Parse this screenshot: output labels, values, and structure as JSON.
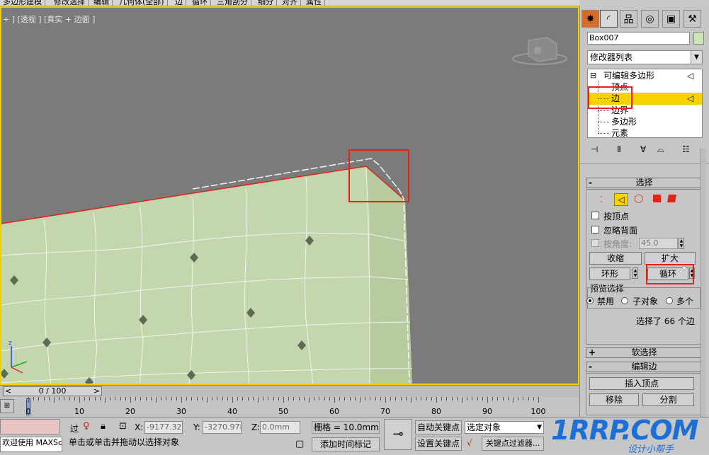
{
  "ribbon": {
    "tabs": [
      "多边形建模",
      "修改选择",
      "编辑",
      "几何体(全部)",
      "边",
      "循环",
      "三角剖分",
      "细分",
      "对齐",
      "属性"
    ]
  },
  "viewport": {
    "label": "+ ] [透视 ] [真实 + 边面 ]",
    "viewcube_label": "前",
    "mesh_color": "#c4d6ad",
    "bg_color": "#7b7b7b",
    "active_border_color": "#f0d000",
    "selection_color": "#e2231a"
  },
  "command_panel": {
    "tab_icons": [
      "create-icon",
      "modify-icon",
      "hierarchy-icon",
      "motion-icon",
      "display-icon",
      "utilities-icon"
    ],
    "object_name": "Box007",
    "modifier_list": "修改器列表",
    "stack": [
      {
        "label": "可编辑多边形",
        "expanded": true
      },
      {
        "label": "顶点"
      },
      {
        "label": "边",
        "selected": true
      },
      {
        "label": "边界"
      },
      {
        "label": "多边形"
      },
      {
        "label": "元素"
      }
    ]
  },
  "selection_rollout": {
    "title": "选择",
    "by_vertex": "按顶点",
    "ignore_backfacing": "忽略背面",
    "by_angle": "按角度:",
    "angle_value": "45.0",
    "shrink": "收缩",
    "grow": "扩大",
    "ring": "环形",
    "loop": "循环",
    "preview_selection": "预览选择",
    "preview_options": [
      "禁用",
      "子对象",
      "多个"
    ],
    "preview_selected": "禁用",
    "selection_status": "选择了 66 个边"
  },
  "soft_selection": {
    "title": "软选择"
  },
  "edit_edges": {
    "title": "编辑边",
    "insert_vertex": "插入顶点",
    "remove": "移除",
    "split": "分割"
  },
  "timeline": {
    "frame_counter": "0 / 100",
    "ticks": [
      "0",
      "10",
      "20",
      "30",
      "40",
      "50",
      "60",
      "70",
      "80",
      "90",
      "100"
    ]
  },
  "status": {
    "maxscript": "欢迎使用 MAXSc",
    "prompt": "单击或单击并拖动以选择对象",
    "x_label": "X:",
    "x_value": "-9177.326r",
    "y_label": "Y:",
    "y_value": "-3270.978r",
    "z_label": "Z:",
    "z_value": "0.0mm",
    "grid": "栅格 = 10.0mm",
    "add_time_tag": "添加时间标记",
    "auto_key": "自动关键点",
    "set_key": "设置关键点",
    "key_filter_dropdown": "选定对象",
    "key_filters": "关键点过滤器..."
  },
  "watermark": {
    "brand": "1RRP.COM",
    "tagline": "设计小帮手"
  }
}
